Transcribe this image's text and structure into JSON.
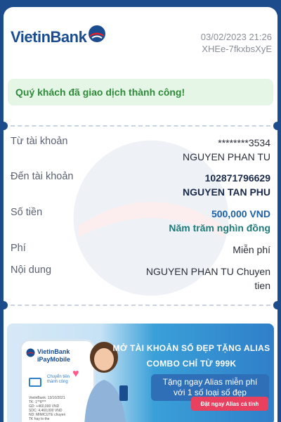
{
  "header": {
    "brand": "VietinBank",
    "datetime": "03/02/2023 21:26",
    "reference": "XHEe-7fkxbsXyE"
  },
  "status": {
    "message": "Quý khách đã giao dịch thành công!"
  },
  "details": {
    "from": {
      "label": "Từ tài khoản",
      "account": "********3534",
      "name": "NGUYEN PHAN TU"
    },
    "to": {
      "label": "Đến tài khoản",
      "account": "102871796629",
      "name": "NGUYEN TAN PHU"
    },
    "amount": {
      "label": "Số tiền",
      "value": "500,000 VND",
      "in_words": "Năm trăm nghìn đồng"
    },
    "fee": {
      "label": "Phí",
      "value": "Miễn phí"
    },
    "content": {
      "label": "Nội dung",
      "line1": "NGUYEN PHAN TU Chuyen",
      "line2": "tien"
    }
  },
  "banner": {
    "phone_brand_line1": "VietinBank",
    "phone_brand_line2": "iPayMobile",
    "phone_notice": "Chuyển tiền thành công",
    "phone_lines": [
      "VietinBank: 13/10/2021",
      "TK: 1**8***",
      "GD: +460,000 VND",
      "SDC: 4,460,000 VND",
      "ND: MIMICUTE chuyen",
      "TK hay lo the"
    ],
    "headline_line1": "MỞ TÀI KHOẢN SỐ ĐẸP TẶNG ALIAS",
    "headline_line2": "COMBO CHỈ TỪ 999K",
    "offer_line1": "Tặng ngay Alias miễn phí",
    "offer_line2": "với 1 số loại số đẹp",
    "cta": "Đặt ngay Alias cá tính"
  },
  "colors": {
    "brand_blue": "#1a4d8f",
    "success_bg": "#e6f6e6",
    "success_text": "#2f8a3a",
    "amount_blue": "#1d5fa6",
    "cta_pink": "#e8405f"
  }
}
